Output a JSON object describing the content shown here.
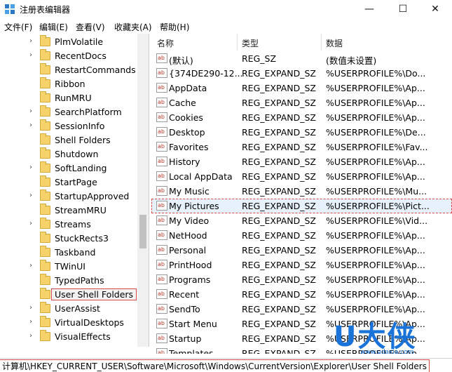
{
  "window": {
    "title": "注册表编辑器",
    "minimize_glyph": "—",
    "maximize_glyph": "☐",
    "close_glyph": "✕"
  },
  "menu": [
    "文件(F)",
    "编辑(E)",
    "查看(V)",
    "收藏夹(A)",
    "帮助(H)"
  ],
  "tree": {
    "items": [
      {
        "label": "PlmVolatile",
        "expandable": true
      },
      {
        "label": "RecentDocs",
        "expandable": true
      },
      {
        "label": "RestartCommands",
        "expandable": false
      },
      {
        "label": "Ribbon",
        "expandable": false
      },
      {
        "label": "RunMRU",
        "expandable": false
      },
      {
        "label": "SearchPlatform",
        "expandable": true
      },
      {
        "label": "SessionInfo",
        "expandable": true
      },
      {
        "label": "Shell Folders",
        "expandable": false
      },
      {
        "label": "Shutdown",
        "expandable": false
      },
      {
        "label": "SoftLanding",
        "expandable": true
      },
      {
        "label": "StartPage",
        "expandable": false
      },
      {
        "label": "StartupApproved",
        "expandable": true
      },
      {
        "label": "StreamMRU",
        "expandable": false
      },
      {
        "label": "Streams",
        "expandable": true
      },
      {
        "label": "StuckRects3",
        "expandable": false
      },
      {
        "label": "Taskband",
        "expandable": false
      },
      {
        "label": "TWinUI",
        "expandable": true
      },
      {
        "label": "TypedPaths",
        "expandable": false
      },
      {
        "label": "User Shell Folders",
        "expandable": false,
        "selected": true
      },
      {
        "label": "UserAssist",
        "expandable": true
      },
      {
        "label": "VirtualDesktops",
        "expandable": true
      },
      {
        "label": "VisualEffects",
        "expandable": true
      }
    ]
  },
  "values": {
    "headers": {
      "name": "名称",
      "type": "类型",
      "data": "数据"
    },
    "icon_text": "ab",
    "rows": [
      {
        "name": "(默认)",
        "type": "REG_SZ",
        "data": "(数值未设置)"
      },
      {
        "name": "{374DE290-12...",
        "type": "REG_EXPAND_SZ",
        "data": "%USERPROFILE%\\Do..."
      },
      {
        "name": "AppData",
        "type": "REG_EXPAND_SZ",
        "data": "%USERPROFILE%\\Ap..."
      },
      {
        "name": "Cache",
        "type": "REG_EXPAND_SZ",
        "data": "%USERPROFILE%\\Ap..."
      },
      {
        "name": "Cookies",
        "type": "REG_EXPAND_SZ",
        "data": "%USERPROFILE%\\Ap..."
      },
      {
        "name": "Desktop",
        "type": "REG_EXPAND_SZ",
        "data": "%USERPROFILE%\\De..."
      },
      {
        "name": "Favorites",
        "type": "REG_EXPAND_SZ",
        "data": "%USERPROFILE%\\Fav..."
      },
      {
        "name": "History",
        "type": "REG_EXPAND_SZ",
        "data": "%USERPROFILE%\\Ap..."
      },
      {
        "name": "Local AppData",
        "type": "REG_EXPAND_SZ",
        "data": "%USERPROFILE%\\Ap..."
      },
      {
        "name": "My Music",
        "type": "REG_EXPAND_SZ",
        "data": "%USERPROFILE%\\Mu..."
      },
      {
        "name": "My Pictures",
        "type": "REG_EXPAND_SZ",
        "data": "%USERPROFILE%\\Pict...",
        "selected": true
      },
      {
        "name": "My Video",
        "type": "REG_EXPAND_SZ",
        "data": "%USERPROFILE%\\Vid..."
      },
      {
        "name": "NetHood",
        "type": "REG_EXPAND_SZ",
        "data": "%USERPROFILE%\\Ap..."
      },
      {
        "name": "Personal",
        "type": "REG_EXPAND_SZ",
        "data": "%USERPROFILE%\\Ap..."
      },
      {
        "name": "PrintHood",
        "type": "REG_EXPAND_SZ",
        "data": "%USERPROFILE%\\Ap..."
      },
      {
        "name": "Programs",
        "type": "REG_EXPAND_SZ",
        "data": "%USERPROFILE%\\Ap..."
      },
      {
        "name": "Recent",
        "type": "REG_EXPAND_SZ",
        "data": "%USERPROFILE%\\Ap..."
      },
      {
        "name": "SendTo",
        "type": "REG_EXPAND_SZ",
        "data": "%USERPROFILE%\\Ap..."
      },
      {
        "name": "Start Menu",
        "type": "REG_EXPAND_SZ",
        "data": "%USERPROFILE%\\Ap..."
      },
      {
        "name": "Startup",
        "type": "REG_EXPAND_SZ",
        "data": "%USERPROFILE%\\Ap..."
      },
      {
        "name": "Templates",
        "type": "REG_EXPAND_SZ",
        "data": "%USERPROFILE%\\Ap..."
      }
    ]
  },
  "status": {
    "path": "计算机\\HKEY_CURRENT_USER\\Software\\Microsoft\\Windows\\CurrentVersion\\Explorer\\User Shell Folders"
  },
  "watermark": {
    "big": "U大侠",
    "url": "www.udaxia.com"
  },
  "colors": {
    "highlight": "#d84848",
    "selection": "#e6f1fb",
    "watermark": "#1a73d9"
  }
}
